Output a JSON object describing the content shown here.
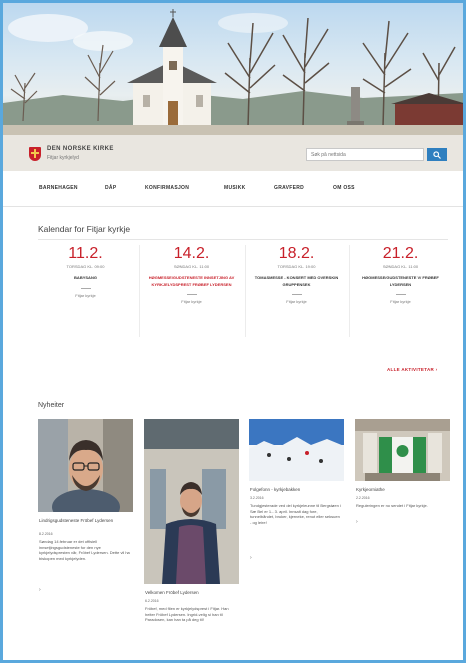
{
  "header": {
    "org_name": "DEN NORSKE KIRKE",
    "org_sub": "Fitjar kyrkjelyd",
    "search_placeholder": "Søk på nettsida"
  },
  "nav": {
    "items": [
      {
        "label": "BARNEHAGEN"
      },
      {
        "label": "DÅP"
      },
      {
        "label": "KONFIRMASJON"
      },
      {
        "label": "MUSIKK"
      },
      {
        "label": "GRAVFERD"
      },
      {
        "label": "OM OSS"
      }
    ]
  },
  "calendar": {
    "heading": "Kalendar for Fitjar kyrkje",
    "events": [
      {
        "date": "11.2.",
        "time": "TORSDAG KL. 09:00",
        "title": "BABYSANG",
        "place": "Fitjar kyrkje",
        "highlight": false
      },
      {
        "date": "14.2.",
        "time": "SØNDAG KL. 11:00",
        "title": "HØGMESSE/GUDSTENESTE INNSETJING AV KYRKJELYDSPREST FRØBEF LYDERSEN",
        "place": "Fitjar kyrkje",
        "highlight": true
      },
      {
        "date": "18.2.",
        "time": "TORSDAG KL. 19:00",
        "title": "TOMASMESSE - KONSERT MED OVERSKIN GRUPPENSEK",
        "place": "Fitjar kyrkje",
        "highlight": false
      },
      {
        "date": "21.2.",
        "time": "SØNDAG KL. 11:00",
        "title": "HØGMESSE/GUDSTENESTE V/ FRØBEF LYDERSEN",
        "place": "Fitjar kyrkje",
        "highlight": false
      }
    ],
    "all_link": "ALLE AKTIVITETAR ›"
  },
  "news": {
    "heading": "Nyheiter",
    "items": [
      {
        "title": "Lindrigsgudsteneste Fröbef Lydersen",
        "date": "8.2.2016",
        "text": "Søndag 14.februar er det offisiell innsetjingsgudsteneste for den nye kyrkjelydspresten vår, Fröbef Lydersen. Dette vil ha biskopen med kyrkjelyden.",
        "caret": "›"
      },
      {
        "title": "Velkomen Fröbef Lydersen",
        "date": "6.2.2016",
        "text": "Fröbef, med filen er kyrkjelydsprest i Fitjar. Han heiter Fröbef Lydersen. Ingrid-velig si han til Paradosen, kan han ta på deg til!",
        "caret": "›"
      },
      {
        "title": "Folgefonn - kyrkjebakken",
        "date": "3.2.2016",
        "text": "Tundgjesterade ved del kyrkjeleunne til Bergstøen i Sæ Bel er 1.- 3. april. Innsalt dag fore, tunnelbåndet, bruker, kjerneke, renut eller seksuen - og leire!",
        "caret": "›"
      },
      {
        "title": "Kyrkjeorniathe",
        "date": "2.2.2016",
        "text": "Reguleringen er no sendet i Fitjar kyrkje.",
        "caret": "›"
      }
    ]
  }
}
